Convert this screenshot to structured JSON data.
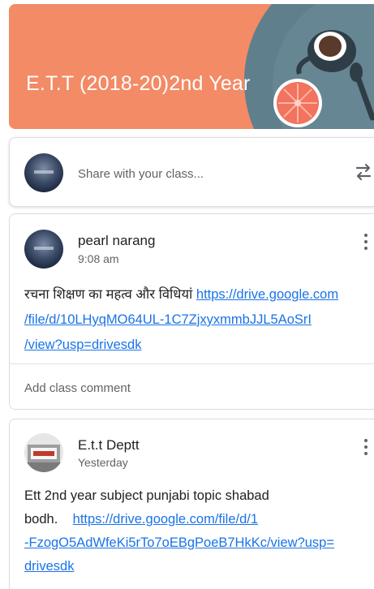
{
  "class_banner": {
    "title": "E.T.T (2018-20)2nd Year",
    "background_color": "#f28b66"
  },
  "share_box": {
    "placeholder": "Share with your class...",
    "repost_icon": "repost-icon"
  },
  "posts": [
    {
      "author": "pearl narang",
      "time": "9:08 am",
      "text": "रचना शिक्षण का महत्व और विधियां",
      "link": "https://drive.google.com/file/d/10LHyqMO64UL-1C7ZjxyxmmbJJL5AoSrI/view?usp=drivesdk",
      "link_lines": [
        "https://drive.google.com",
        "/file/d/10LHyqMO64UL-1C7ZjxyxmmbJJL5AoSrI",
        "/view?usp=drivesdk"
      ],
      "comment_placeholder": "Add class comment"
    },
    {
      "author": "E.t.t Deptt",
      "time": "Yesterday",
      "text_line1": "Ett 2nd year  subject punjabi  topic  shabad",
      "text_line2": "bodh.",
      "link": "https://drive.google.com/file/d/1-FzogO5AdWfeKi5rTo7oEBgPoeB7HkKc/view?usp=drivesdk",
      "link_lines": [
        "https://drive.google.com/file/d/1",
        "-FzogO5AdWfeKi5rTo7oEBgPoeB7HkKc/view?usp=",
        "drivesdk"
      ]
    }
  ],
  "colors": {
    "link": "#1a73e8",
    "secondary_text": "#5f6368"
  }
}
